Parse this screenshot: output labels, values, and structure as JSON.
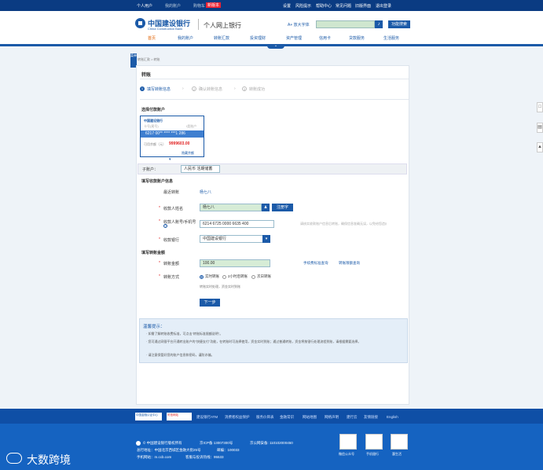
{
  "topbar": {
    "personal": "个人用户",
    "myaccount": "我的账户",
    "cart": "购物车",
    "cart_badge": "新版本",
    "settings": "设置",
    "risk": "风险提示",
    "help": "帮助中心",
    "feedback": "常见问题",
    "myfavorites": "旧版界面",
    "logout": "退出登录"
  },
  "header": {
    "bank_cn": "中国建设银行",
    "bank_en": "China Construction Bank",
    "portal": "个人网上银行",
    "font_size": "A+ 放大字体",
    "search_placeholder": "",
    "func_search": "功能搜索"
  },
  "nav": [
    "首页",
    "我的账户",
    "转账汇款",
    "投资理财",
    "资产管理",
    "信用卡",
    "贷款服务",
    "生活服务"
  ],
  "breadcrumb": "转账汇款 > 转账",
  "rail_label": "菜单",
  "page": {
    "title": "转账",
    "steps": [
      "填写转账信息",
      "确认转账信息",
      "转账成功"
    ]
  },
  "payer": {
    "section": "选择付款账户",
    "bank": "中国建设银行",
    "account_label": "卡号(尾号)",
    "account_type": "I类账户",
    "account_no": "6217 00** **** ***1 286",
    "balance_label": "可用余额（元）",
    "balance": "9999603.00",
    "select_all": "隐藏余额",
    "sub_label": "子账户：",
    "sub_value": "人民币 活期储蓄"
  },
  "payee": {
    "section": "填写收款账户信息",
    "recent_label": "最近转账",
    "recent_value": "杨七八",
    "name_label": "收款人姓名",
    "name_value": "杨七八",
    "book_btn": "注册字",
    "acct_label": "收款人账号/手机号",
    "acct_value": "6214 6725 0000 6635 400",
    "acct_hint": "请核实收款账户信息后转账，确保信息准确无误，以免给您造成损失。",
    "bank_label": "收款银行",
    "bank_value": "中国建设银行"
  },
  "amount": {
    "section": "填写转账金额",
    "amount_label": "转账金额",
    "amount_value": "100.00",
    "fee_link": "手续费标准查询",
    "limit_link": "转账限额查询",
    "mode_label": "转账方式",
    "modes": [
      "实时转账",
      "2小时后转账",
      "次日转账"
    ],
    "mode_note": "转账实时处理，资金实时到账",
    "next": "下一步"
  },
  "tips": {
    "title": "温馨提示：",
    "line1": "· 如需了解转账收费标准，可点击\"转账标准限额说明\"。",
    "line2": "· 您可通过网银平台开通转出账户的\"快捷支付\"功能，在转账时可选择使用，资金实时到账；通过普通转账，资金将按银行处理流程到账，请根据需要选择。",
    "line3": "· 请注意保管好您的账户信息和密码，谨防诈骗。"
  },
  "footer": {
    "badge1": "中国金融认证中心",
    "badge2": "可信网站",
    "links": [
      "建设银行ATM",
      "消费者权益保护",
      "服务价目表",
      "金融常识",
      "网站地图",
      "网络声明",
      "建行云",
      "友情链接",
      "English"
    ],
    "copyright": "© 中国建设银行版权所有",
    "icp": "京ICP备 13007300号",
    "police": "京公网安备: 110102000450",
    "address": "总行地址：中国北京西城区金融大街25号",
    "postcode": "邮编：100033",
    "mobile": "手机网站：m.ccb.com",
    "hotline": "客服与投诉热线：95533",
    "qrs": [
      "微信公众号",
      "手机银行",
      "惠生活"
    ],
    "watermark": "大数跨境"
  }
}
